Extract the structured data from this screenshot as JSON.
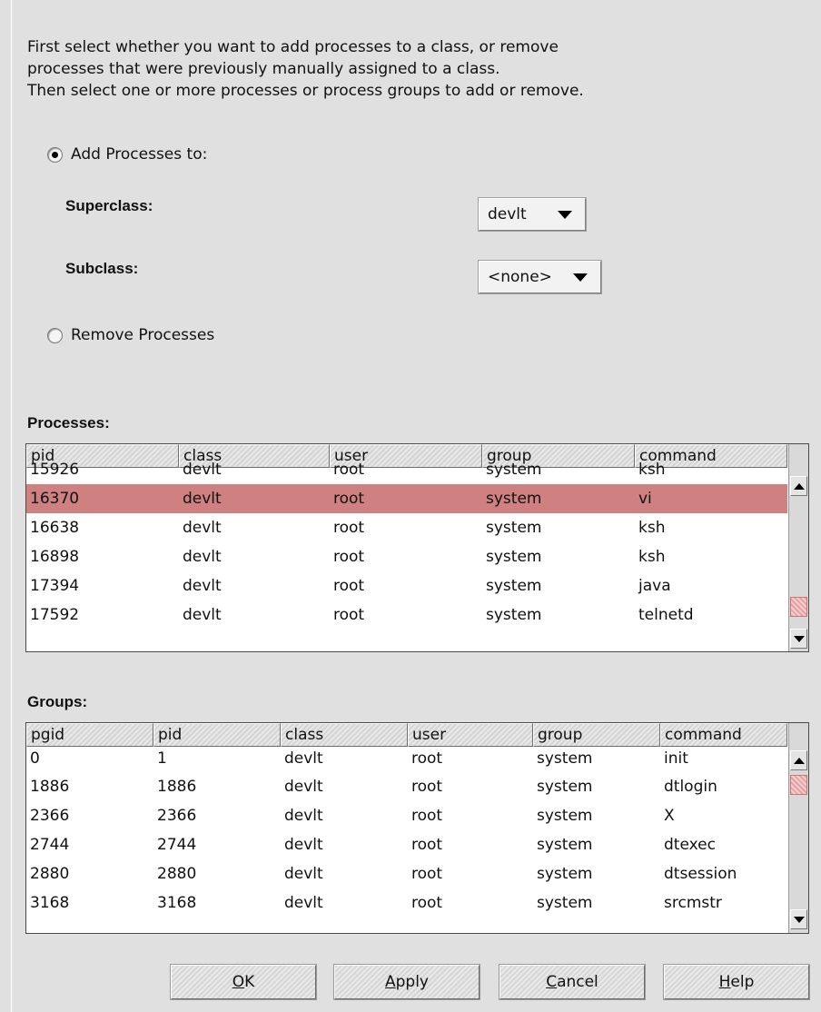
{
  "intro": {
    "line1": "First select whether you want to add processes to a class, or remove",
    "line2": "processes that were previously manually assigned to a class.",
    "line3": "Then select one or more processes or process groups to add or remove."
  },
  "add_option": {
    "label": "Add Processes to:",
    "selected": true
  },
  "superclass": {
    "label": "Superclass:",
    "value": "devlt"
  },
  "subclass": {
    "label": "Subclass:",
    "value": "<none>"
  },
  "remove_option": {
    "label": "Remove Processes",
    "selected": false
  },
  "processes": {
    "title": "Processes:",
    "columns": [
      "pid",
      "class",
      "user",
      "group",
      "command"
    ],
    "rows": [
      [
        "15926",
        "devlt",
        "root",
        "system",
        "ksh"
      ],
      [
        "16370",
        "devlt",
        "root",
        "system",
        "vi"
      ],
      [
        "16638",
        "devlt",
        "root",
        "system",
        "ksh"
      ],
      [
        "16898",
        "devlt",
        "root",
        "system",
        "ksh"
      ],
      [
        "17394",
        "devlt",
        "root",
        "system",
        "java"
      ],
      [
        "17592",
        "devlt",
        "root",
        "system",
        "telnetd"
      ]
    ],
    "selected_row": "16370",
    "highlight_color": "#cf8080"
  },
  "groups": {
    "title": "Groups:",
    "columns": [
      "pgid",
      "pid",
      "class",
      "user",
      "group",
      "command"
    ],
    "rows": [
      [
        "0",
        "1",
        "devlt",
        "root",
        "system",
        "init"
      ],
      [
        "1886",
        "1886",
        "devlt",
        "root",
        "system",
        "dtlogin"
      ],
      [
        "2366",
        "2366",
        "devlt",
        "root",
        "system",
        "X"
      ],
      [
        "2744",
        "2744",
        "devlt",
        "root",
        "system",
        "dtexec"
      ],
      [
        "2880",
        "2880",
        "devlt",
        "root",
        "system",
        "dtsession"
      ],
      [
        "3168",
        "3168",
        "devlt",
        "root",
        "system",
        "srcmstr"
      ]
    ]
  },
  "buttons": {
    "ok": {
      "mnemonic": "O",
      "rest": "K"
    },
    "apply": {
      "mnemonic": "A",
      "rest": "pply"
    },
    "cancel": {
      "mnemonic": "C",
      "rest": "ancel"
    },
    "help": {
      "mnemonic": "H",
      "rest": "elp"
    }
  },
  "icons": {
    "dropdown": "chevron-down-icon",
    "scroll_up": "arrow-up-icon",
    "scroll_down": "arrow-down-icon"
  }
}
